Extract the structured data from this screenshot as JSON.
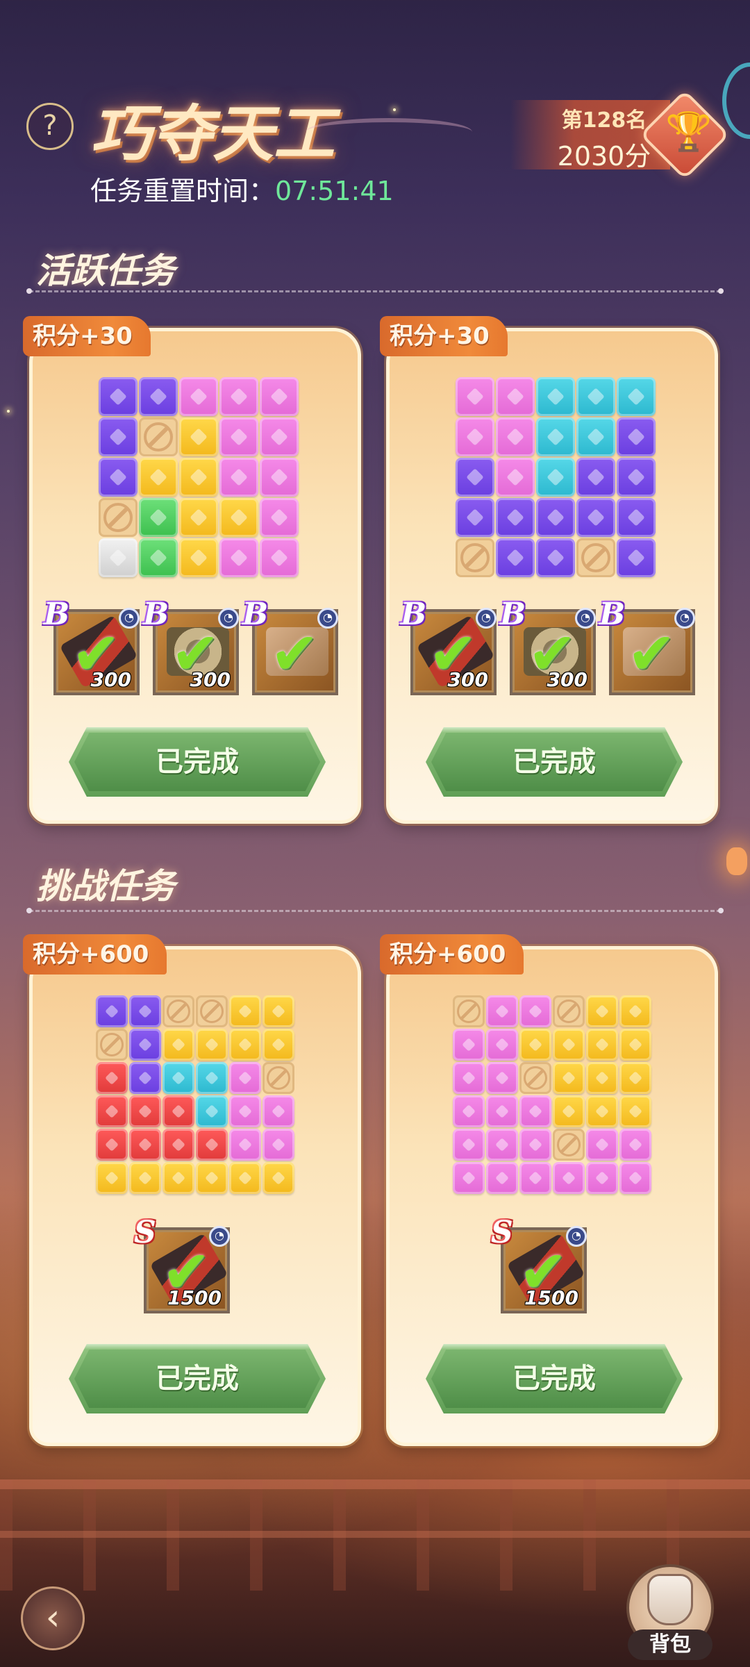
{
  "header": {
    "help_label": "?",
    "title": "巧夺天工",
    "reset_label": "任务重置时间：",
    "reset_time": "07:51:41",
    "rank": "第128名",
    "score": "2030分"
  },
  "sections": {
    "active": "活跃任务",
    "challenge": "挑战任务"
  },
  "active_tasks": [
    {
      "badge": "积分+30",
      "grid": [
        [
          "purple",
          "purple",
          "pink",
          "pink",
          "pink"
        ],
        [
          "purple",
          "block",
          "yellow",
          "pink",
          "pink"
        ],
        [
          "purple",
          "yellow",
          "yellow",
          "pink",
          "pink"
        ],
        [
          "block",
          "green",
          "yellow",
          "yellow",
          "pink"
        ],
        [
          "white",
          "green",
          "yellow",
          "pink",
          "pink"
        ]
      ],
      "rewards": [
        {
          "grade": "B",
          "qty": "300",
          "icon": "scroll-icon"
        },
        {
          "grade": "B",
          "qty": "300",
          "icon": "coin-icon"
        },
        {
          "grade": "B",
          "qty": "",
          "icon": "puzzle-icon"
        }
      ],
      "button": "已完成"
    },
    {
      "badge": "积分+30",
      "grid": [
        [
          "pink",
          "pink",
          "cyan",
          "cyan",
          "cyan"
        ],
        [
          "pink",
          "pink",
          "cyan",
          "cyan",
          "purple"
        ],
        [
          "purple",
          "pink",
          "cyan",
          "purple",
          "purple"
        ],
        [
          "purple",
          "purple",
          "purple",
          "purple",
          "purple"
        ],
        [
          "block",
          "purple",
          "purple",
          "block",
          "purple"
        ]
      ],
      "rewards": [
        {
          "grade": "B",
          "qty": "300",
          "icon": "scroll-icon"
        },
        {
          "grade": "B",
          "qty": "300",
          "icon": "coin-icon"
        },
        {
          "grade": "B",
          "qty": "",
          "icon": "puzzle-icon"
        }
      ],
      "button": "已完成"
    }
  ],
  "challenge_tasks": [
    {
      "badge": "积分+600",
      "grid": [
        [
          "purple",
          "purple",
          "block",
          "block",
          "yellow",
          "yellow"
        ],
        [
          "block",
          "purple",
          "yellow",
          "yellow",
          "yellow",
          "yellow"
        ],
        [
          "red",
          "purple",
          "cyan",
          "cyan",
          "pink",
          "block"
        ],
        [
          "red",
          "red",
          "red",
          "cyan",
          "pink",
          "pink"
        ],
        [
          "red",
          "red",
          "red",
          "red",
          "pink",
          "pink"
        ],
        [
          "yellow",
          "yellow",
          "yellow",
          "yellow",
          "yellow",
          "yellow"
        ]
      ],
      "rewards": [
        {
          "grade": "S",
          "qty": "1500",
          "icon": "scroll-icon"
        }
      ],
      "button": "已完成"
    },
    {
      "badge": "积分+600",
      "grid": [
        [
          "block",
          "pink",
          "pink",
          "block",
          "yellow",
          "yellow"
        ],
        [
          "pink",
          "pink",
          "yellow",
          "yellow",
          "yellow",
          "yellow"
        ],
        [
          "pink",
          "pink",
          "block",
          "yellow",
          "yellow",
          "yellow"
        ],
        [
          "pink",
          "pink",
          "pink",
          "yellow",
          "yellow",
          "yellow"
        ],
        [
          "pink",
          "pink",
          "pink",
          "block",
          "pink",
          "pink"
        ],
        [
          "pink",
          "pink",
          "pink",
          "pink",
          "pink",
          "pink"
        ]
      ],
      "rewards": [
        {
          "grade": "S",
          "qty": "1500",
          "icon": "scroll-icon"
        }
      ],
      "button": "已完成"
    }
  ],
  "footer": {
    "bag_label": "背包"
  },
  "colors": {
    "time": "#6fe89a",
    "badge": "#f08a3a",
    "done_button": "#5f9e55"
  }
}
